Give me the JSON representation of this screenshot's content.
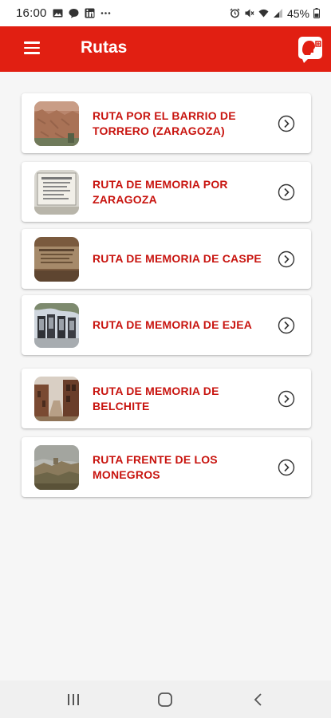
{
  "status_bar": {
    "time": "16:00",
    "battery_percent": "45%",
    "left_icons": [
      "gallery-icon",
      "chat-icon",
      "linkedin-icon",
      "more-dots-icon"
    ],
    "right_icons": [
      "alarm-icon",
      "mute-icon",
      "wifi-icon",
      "signal-icon",
      "battery-icon"
    ]
  },
  "app_bar": {
    "title": "Rutas",
    "accent_color": "#e11f12",
    "menu_icon": "hamburger-menu-icon",
    "logo_icon": "app-logo-icon"
  },
  "routes": [
    {
      "label": "RUTA POR EL BARRIO DE TORRERO (ZARAGOZA)",
      "thumbnail": "torrero-wall-photo"
    },
    {
      "label": "RUTA DE MEMORIA POR ZARAGOZA",
      "thumbnail": "memorial-plaque-photo"
    },
    {
      "label": "RUTA DE MEMORIA DE CASPE",
      "thumbnail": "caspe-plaque-photo"
    },
    {
      "label": "RUTA DE MEMORIA DE EJEA",
      "thumbnail": "ejea-monument-photo"
    },
    {
      "label": "RUTA DE MEMORIA DE BELCHITE",
      "thumbnail": "belchite-ruins-photo"
    },
    {
      "label": "RUTA FRENTE DE LOS MONEGROS",
      "thumbnail": "monegros-landscape-photo"
    }
  ],
  "route_text_color": "#c8140f",
  "nav_bar": {
    "buttons": [
      "recent-apps-icon",
      "home-icon",
      "back-icon"
    ]
  }
}
